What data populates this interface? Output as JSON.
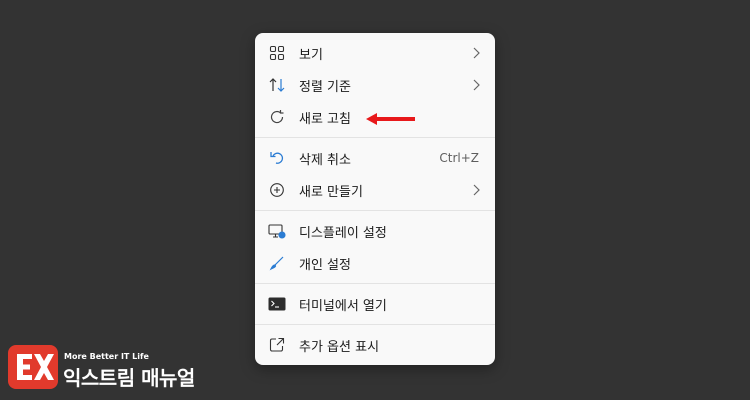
{
  "context_menu": {
    "items": [
      {
        "label": "보기",
        "icon": "grid-icon",
        "has_submenu": true
      },
      {
        "label": "정렬 기준",
        "icon": "sort-icon",
        "has_submenu": true
      },
      {
        "label": "새로 고침",
        "icon": "refresh-icon",
        "has_submenu": false
      },
      {
        "label": "삭제 취소",
        "icon": "undo-icon",
        "shortcut": "Ctrl+Z"
      },
      {
        "label": "새로 만들기",
        "icon": "add-circle-icon",
        "has_submenu": true
      },
      {
        "label": "디스플레이 설정",
        "icon": "display-settings-icon"
      },
      {
        "label": "개인 설정",
        "icon": "brush-icon"
      },
      {
        "label": "터미널에서 열기",
        "icon": "terminal-icon"
      },
      {
        "label": "추가 옵션 표시",
        "icon": "share-icon"
      }
    ]
  },
  "annotation": {
    "arrow_color": "#e8191b",
    "target": "새로 고침"
  },
  "watermark": {
    "tagline": "More Better IT Life",
    "name": "익스트림 매뉴얼",
    "badge_color": "#e13a2c"
  },
  "colors": {
    "background": "#333333",
    "menu_bg": "#f9f9f9",
    "accent": "#2b7cd3"
  }
}
